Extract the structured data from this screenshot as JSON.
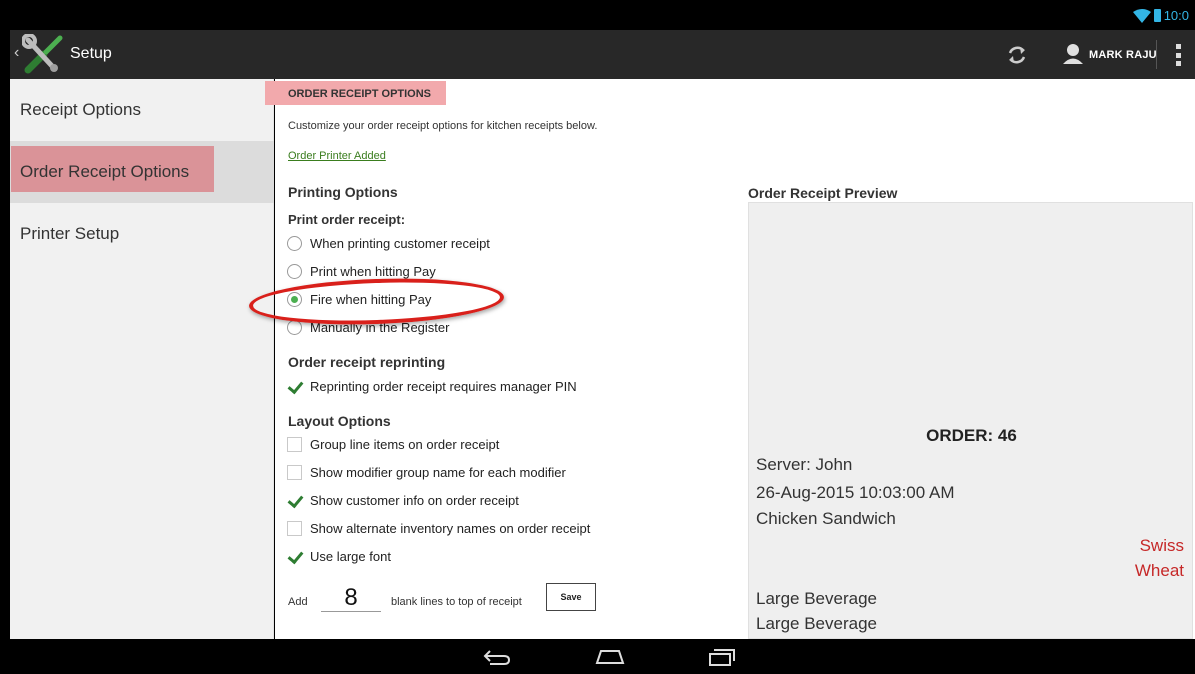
{
  "status_bar": {
    "time": "10:0"
  },
  "action_bar": {
    "back_glyph": "‹",
    "title": "Setup",
    "user_name": "MARK RAJU",
    "icons": [
      "setup-tools-icon",
      "sync-icon",
      "user-icon",
      "overflow-menu-icon"
    ]
  },
  "sidebar": {
    "items": [
      {
        "label": "Receipt Options",
        "active": false
      },
      {
        "label": "Order Receipt Options",
        "active": true
      },
      {
        "label": "Printer Setup",
        "active": false
      }
    ]
  },
  "main": {
    "section_title": "ORDER RECEIPT OPTIONS",
    "description": "Customize your order receipt options for kitchen receipts below.",
    "printer_link": "Order Printer Added",
    "printing_options": {
      "heading": "Printing Options",
      "subheading": "Print order receipt:",
      "radios": [
        {
          "label": "When printing customer receipt",
          "checked": false
        },
        {
          "label": "Print when hitting Pay",
          "checked": false
        },
        {
          "label": "Fire when hitting Pay",
          "checked": true
        },
        {
          "label": "Manually in the Register",
          "checked": false
        }
      ]
    },
    "reprinting": {
      "heading": "Order receipt reprinting",
      "option": {
        "label": "Reprinting order receipt requires manager PIN",
        "checked": true
      }
    },
    "layout_options": {
      "heading": "Layout Options",
      "checks": [
        {
          "label": "Group line items on order receipt",
          "checked": false
        },
        {
          "label": "Show modifier group name for each modifier",
          "checked": false
        },
        {
          "label": "Show customer info on order receipt",
          "checked": true
        },
        {
          "label": "Show alternate inventory names on order receipt",
          "checked": false
        },
        {
          "label": "Use large font",
          "checked": true
        }
      ]
    },
    "blank_lines": {
      "prefix": "Add",
      "value": "8",
      "suffix": "blank lines to top of receipt",
      "save_label": "Save"
    }
  },
  "preview": {
    "title": "Order Receipt Preview",
    "order_label": "ORDER: 46",
    "server": "Server: John",
    "datetime": "26-Aug-2015 10:03:00 AM",
    "item1": "Chicken Sandwich",
    "modifier1": "Swiss",
    "modifier2": "Wheat",
    "item2": "Large Beverage",
    "item3": "Large Beverage"
  },
  "colors": {
    "accent_green": "#4caf50",
    "highlight_red": "#d9201b",
    "section_tag": "#f2a9ac",
    "status_blue": "#33b5e5"
  }
}
